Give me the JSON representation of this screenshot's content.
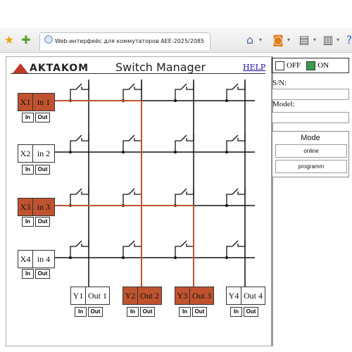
{
  "browser": {
    "tab_title": "Web-интерфейс для коммутаторов AEE-2025/2085",
    "icons": [
      "star-icon",
      "add-bookmark-icon",
      "home-icon",
      "rss-icon",
      "print-icon",
      "page-icon",
      "help-icon"
    ]
  },
  "app": {
    "logo_text": "AKTAKOM",
    "title": "Switch Manager",
    "help_label": "HELP"
  },
  "legend": {
    "off_label": "OFF",
    "on_label": "ON",
    "off_color": "#ffffff",
    "on_color": "#3a9a4a"
  },
  "device": {
    "sn_label": "S/N:",
    "sn_value": "",
    "model_label": "Model:",
    "model_value": ""
  },
  "mode": {
    "title": "Mode",
    "buttons": [
      "online",
      "programm"
    ]
  },
  "colors": {
    "active": "#c0532f",
    "line": "#111111"
  },
  "io_buttons": {
    "in_label": "In",
    "out_label": "Out"
  },
  "inputs": [
    {
      "id": "X1",
      "name": "in 1",
      "active": true
    },
    {
      "id": "X2",
      "name": "in 2",
      "active": false
    },
    {
      "id": "X3",
      "name": "in 3",
      "active": true
    },
    {
      "id": "X4",
      "name": "in 4",
      "active": false
    }
  ],
  "outputs": [
    {
      "id": "Y1",
      "name": "Out 1",
      "active": false
    },
    {
      "id": "Y2",
      "name": "Out 2",
      "active": true
    },
    {
      "id": "Y3",
      "name": "Out 3",
      "active": true
    },
    {
      "id": "Y4",
      "name": "Out 4",
      "active": false
    }
  ],
  "crosspoints_closed": [
    [
      0,
      1
    ],
    [
      2,
      2
    ]
  ]
}
